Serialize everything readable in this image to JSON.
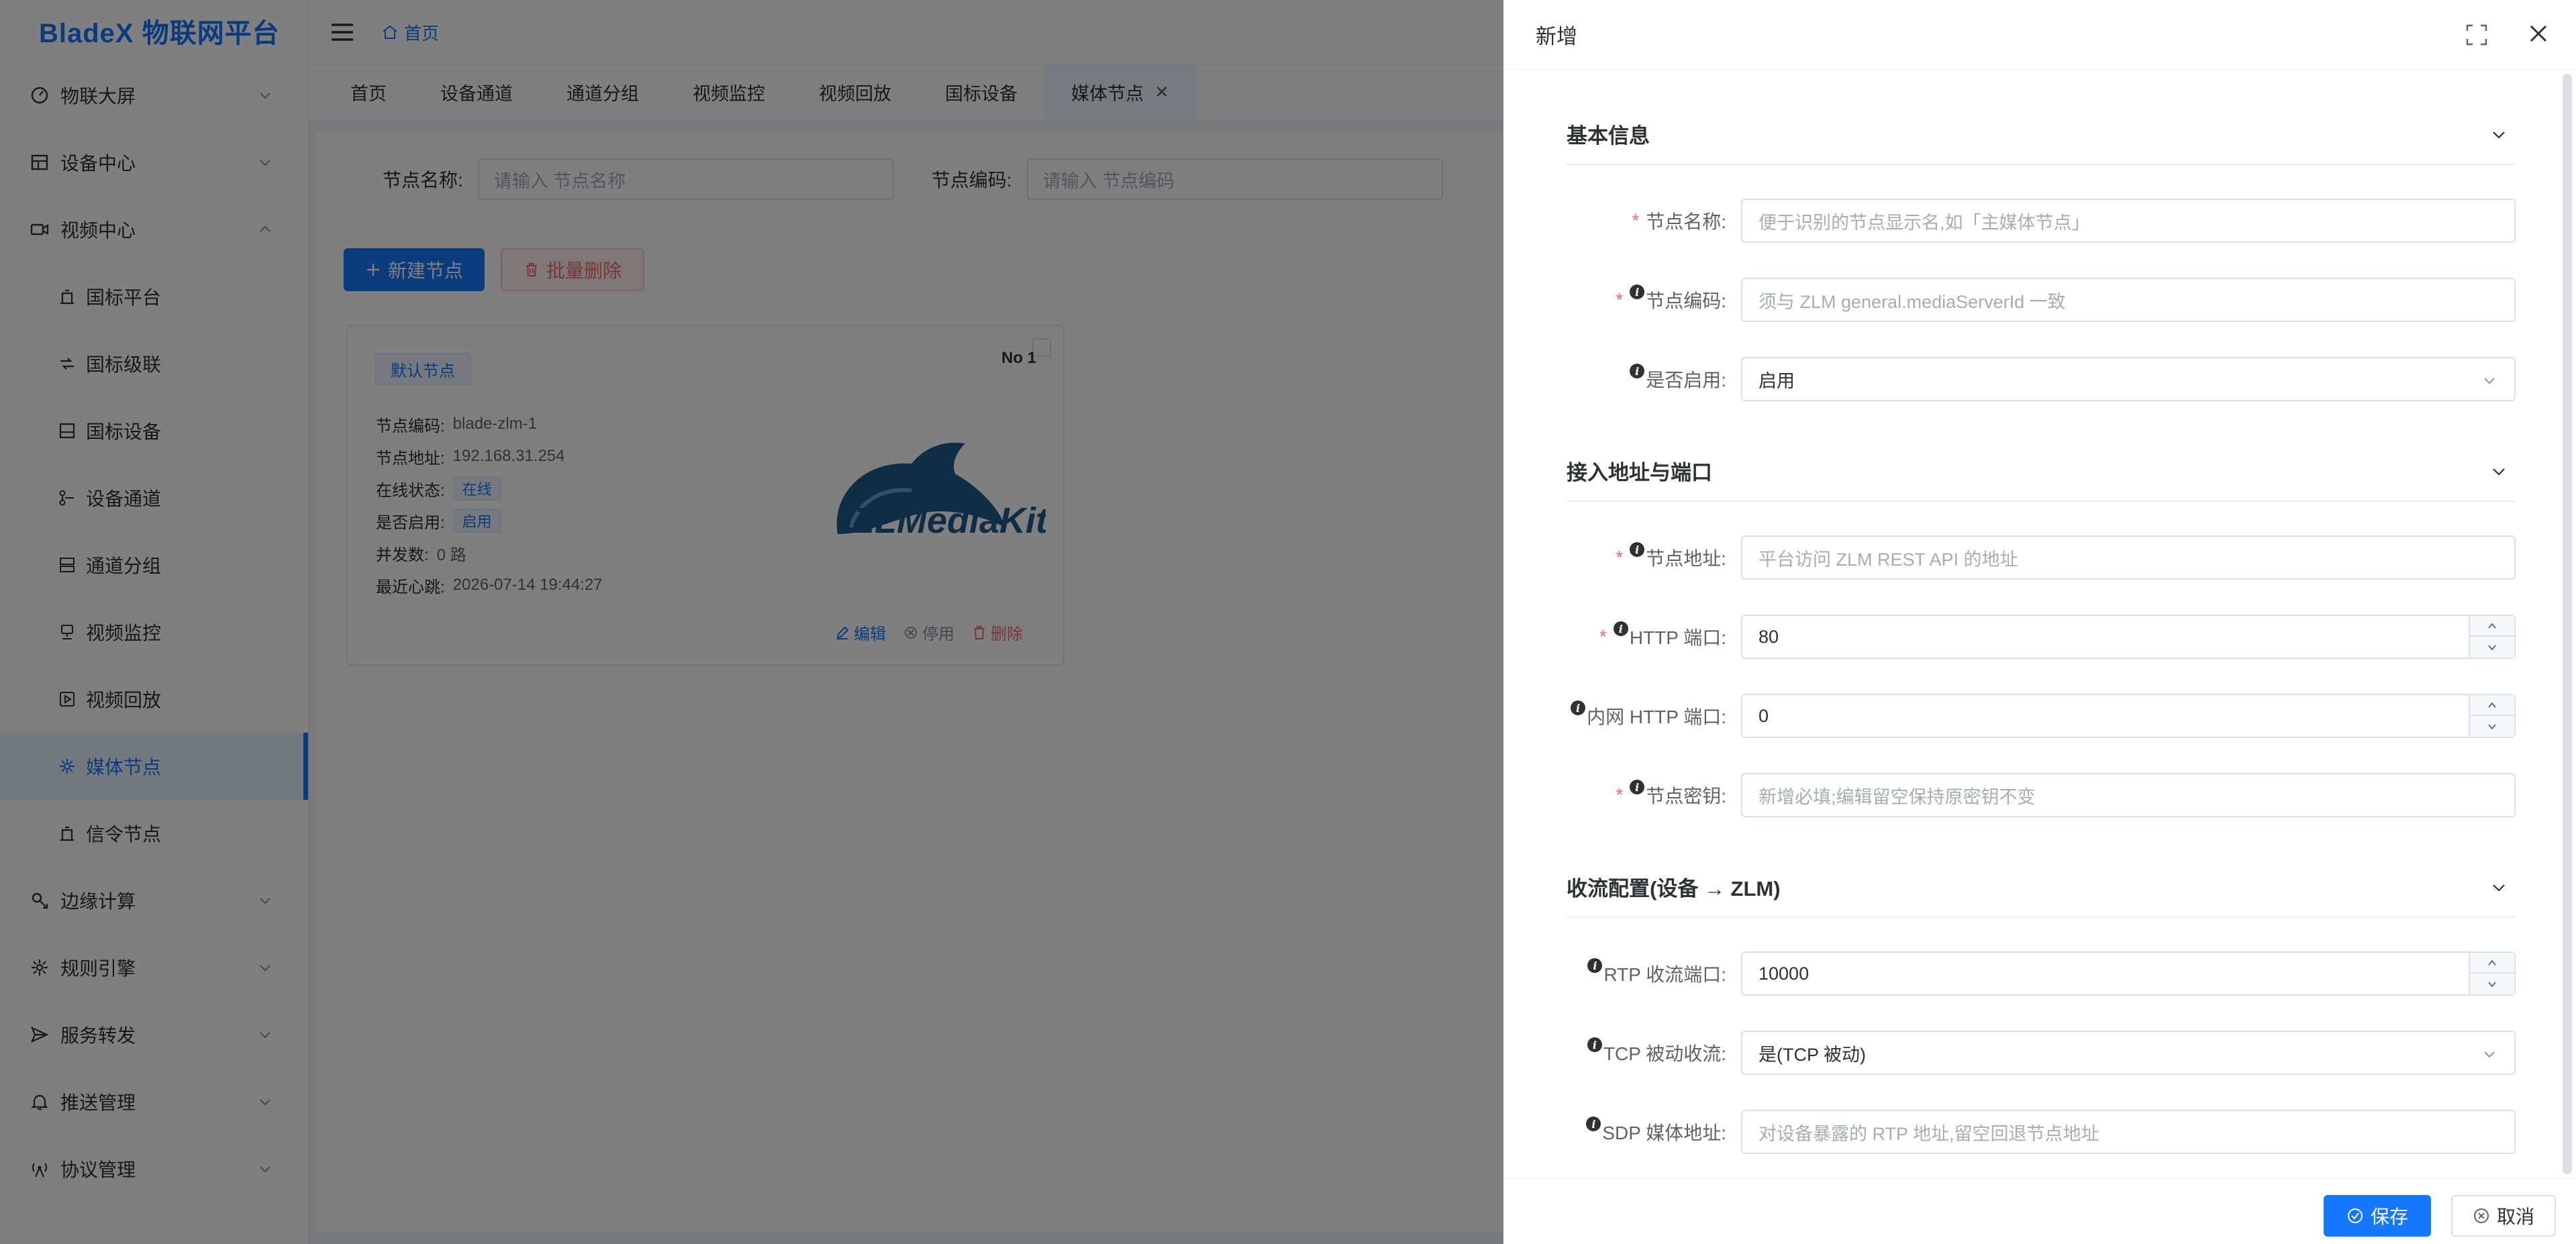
{
  "app": {
    "title": "BladeX 物联网平台"
  },
  "header": {
    "breadcrumb": "首页"
  },
  "sidebar": {
    "items": [
      {
        "label": "物联大屏"
      },
      {
        "label": "设备中心"
      },
      {
        "label": "视频中心"
      },
      {
        "label": "边缘计算"
      },
      {
        "label": "规则引擎"
      },
      {
        "label": "服务转发"
      },
      {
        "label": "推送管理"
      },
      {
        "label": "协议管理"
      }
    ],
    "video_sub": [
      {
        "label": "国标平台"
      },
      {
        "label": "国标级联"
      },
      {
        "label": "国标设备"
      },
      {
        "label": "设备通道"
      },
      {
        "label": "通道分组"
      },
      {
        "label": "视频监控"
      },
      {
        "label": "视频回放"
      },
      {
        "label": "媒体节点"
      },
      {
        "label": "信令节点"
      }
    ]
  },
  "tabs": [
    {
      "label": "首页"
    },
    {
      "label": "设备通道"
    },
    {
      "label": "通道分组"
    },
    {
      "label": "视频监控"
    },
    {
      "label": "视频回放"
    },
    {
      "label": "国标设备"
    },
    {
      "label": "媒体节点"
    }
  ],
  "search": {
    "name_label": "节点名称:",
    "name_placeholder": "请输入 节点名称",
    "code_label": "节点编码:",
    "code_placeholder": "请输入 节点编码"
  },
  "toolbar": {
    "new_label": "新建节点",
    "batch_delete_label": "批量删除"
  },
  "card": {
    "tag": "默认节点",
    "no": "No 1",
    "code_key": "节点编码:",
    "code_val": "blade-zlm-1",
    "addr_key": "节点地址:",
    "addr_val": "192.168.31.254",
    "online_key": "在线状态:",
    "online_val": "在线",
    "enabled_key": "是否启用:",
    "enabled_val": "启用",
    "concurrency_key": "并发数:",
    "concurrency_val": "0 路",
    "heartbeat_key": "最近心跳:",
    "heartbeat_val": "2026-07-14 19:44:27",
    "logo_text": "ZLMediaKit",
    "edit": "编辑",
    "disable": "停用",
    "delete": "删除"
  },
  "drawer": {
    "title": "新增",
    "sections": {
      "basic": "基本信息",
      "address": "接入地址与端口",
      "stream": "收流配置(设备 → ZLM)"
    },
    "fields": {
      "node_name": {
        "label": "节点名称:",
        "placeholder": "便于识别的节点显示名,如「主媒体节点」"
      },
      "node_code": {
        "label": "节点编码:",
        "placeholder": "须与 ZLM general.mediaServerId 一致"
      },
      "enabled": {
        "label": "是否启用:",
        "value": "启用"
      },
      "node_addr": {
        "label": "节点地址:",
        "placeholder": "平台访问 ZLM REST API 的地址"
      },
      "http_port": {
        "label": "HTTP 端口:",
        "value": "80"
      },
      "inner_http_port": {
        "label": "内网 HTTP 端口:",
        "value": "0"
      },
      "secret": {
        "label": "节点密钥:",
        "placeholder": "新增必填;编辑留空保持原密钥不变"
      },
      "rtp_port": {
        "label": "RTP 收流端口:",
        "value": "10000"
      },
      "tcp_passive": {
        "label": "TCP 被动收流:",
        "value": "是(TCP 被动)"
      },
      "sdp_addr": {
        "label": "SDP 媒体地址:",
        "placeholder": "对设备暴露的 RTP 地址,留空回退节点地址"
      }
    },
    "save": "保存",
    "cancel": "取消"
  },
  "colors": {
    "primary": "#1677ff",
    "danger": "#f56c6c",
    "overlay": "rgba(0,0,0,0.5)"
  }
}
